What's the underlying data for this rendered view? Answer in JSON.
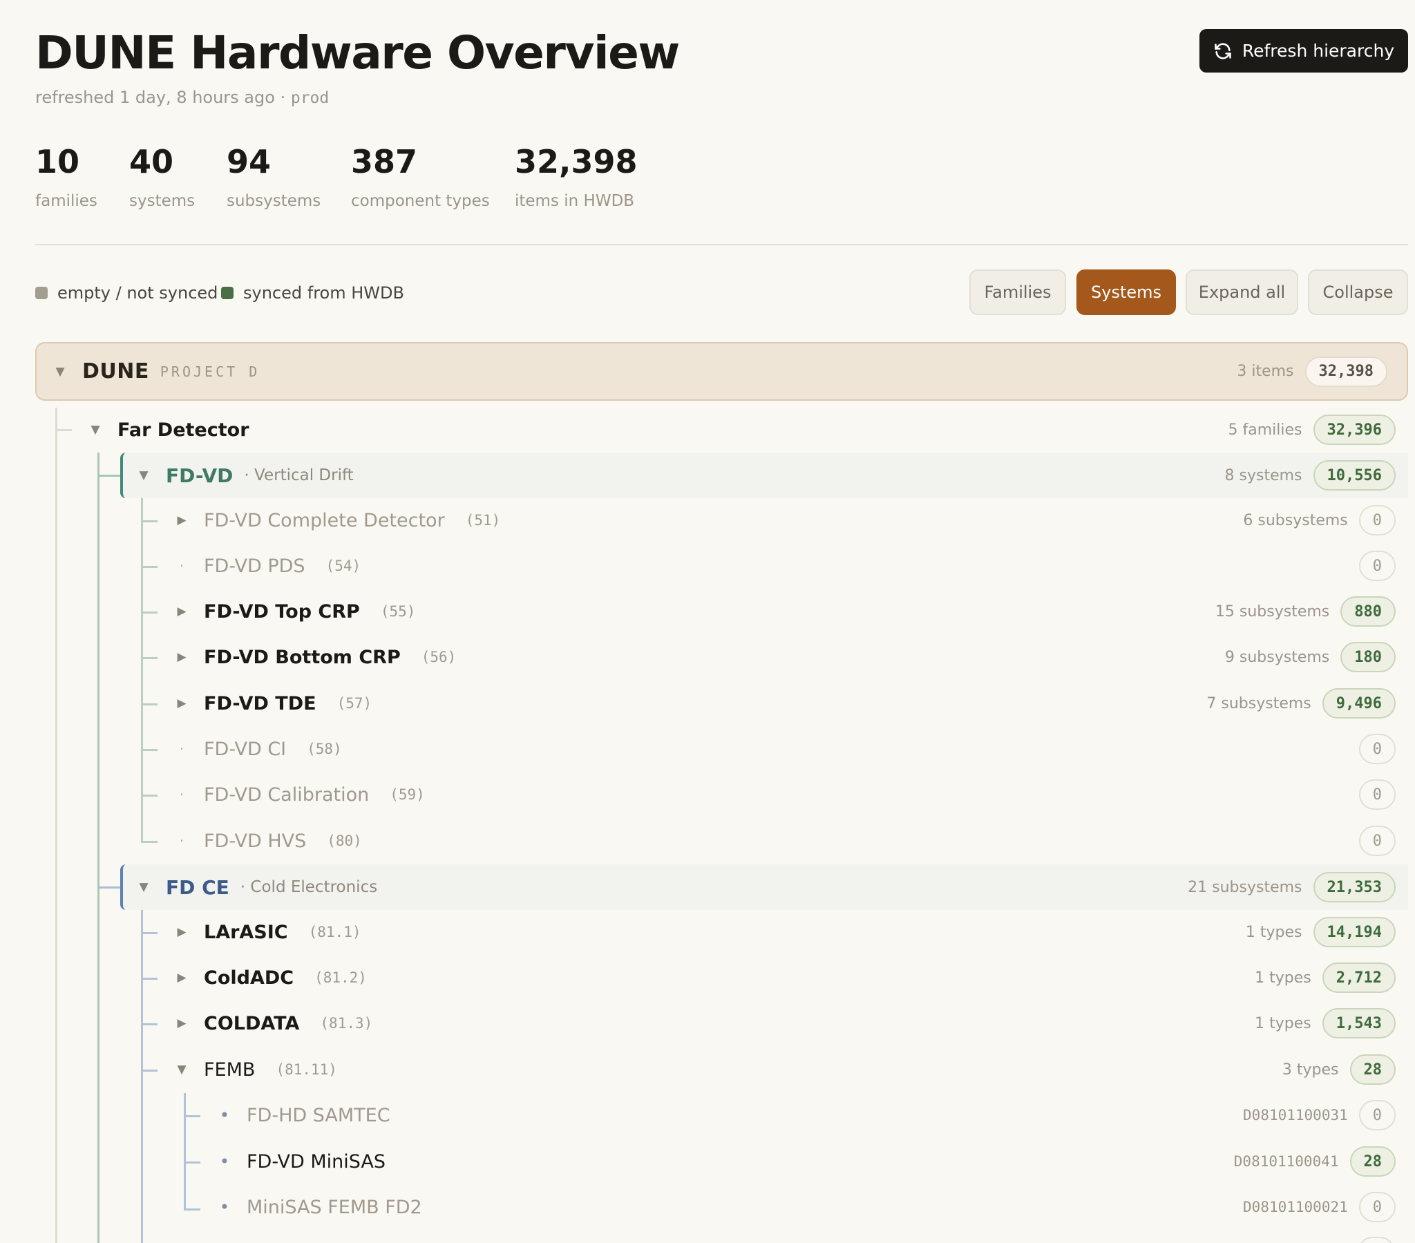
{
  "header": {
    "title": "DUNE Hardware Overview",
    "refreshed": "refreshed 1 day, 8 hours ago ·",
    "env": "prod",
    "refresh_button": "Refresh hierarchy"
  },
  "stats": [
    {
      "value": "10",
      "label": "families"
    },
    {
      "value": "40",
      "label": "systems"
    },
    {
      "value": "94",
      "label": "subsystems"
    },
    {
      "value": "387",
      "label": "component types"
    },
    {
      "value": "32,398",
      "label": "items in HWDB"
    }
  ],
  "legend": {
    "empty": "empty / not synced",
    "synced": "synced from HWDB",
    "empty_color": "#a39d90",
    "synced_color": "#4a6e45"
  },
  "views": {
    "families": "Families",
    "systems": "Systems",
    "expand": "Expand all",
    "collapse": "Collapse",
    "active": "Systems"
  },
  "tree": {
    "root": {
      "name": "DUNE",
      "tag": "PROJECT D",
      "meta": "3 items",
      "count": "32,398"
    },
    "far_detector": {
      "name": "Far Detector",
      "meta": "5 families",
      "count": "32,396"
    },
    "fdvd": {
      "name": "FD-VD",
      "desc": "· Vertical Drift",
      "meta": "8 systems",
      "count": "10,556",
      "systems": [
        {
          "name": "FD-VD Complete Detector",
          "code": "(51)",
          "meta": "6 subsystems",
          "count": "0"
        },
        {
          "name": "FD-VD PDS",
          "code": "(54)",
          "meta": "",
          "count": "0"
        },
        {
          "name": "FD-VD Top CRP",
          "code": "(55)",
          "meta": "15 subsystems",
          "count": "880"
        },
        {
          "name": "FD-VD Bottom CRP",
          "code": "(56)",
          "meta": "9 subsystems",
          "count": "180"
        },
        {
          "name": "FD-VD TDE",
          "code": "(57)",
          "meta": "7 subsystems",
          "count": "9,496"
        },
        {
          "name": "FD-VD CI",
          "code": "(58)",
          "meta": "",
          "count": "0"
        },
        {
          "name": "FD-VD Calibration",
          "code": "(59)",
          "meta": "",
          "count": "0"
        },
        {
          "name": "FD-VD HVS",
          "code": "(80)",
          "meta": "",
          "count": "0"
        }
      ]
    },
    "fdce": {
      "name": "FD CE",
      "desc": "· Cold Electronics",
      "meta": "21 subsystems",
      "count": "21,353",
      "subsystems": [
        {
          "name": "LArASIC",
          "code": "(81.1)",
          "meta": "1 types",
          "count": "14,194"
        },
        {
          "name": "ColdADC",
          "code": "(81.2)",
          "meta": "1 types",
          "count": "2,712"
        },
        {
          "name": "COLDATA",
          "code": "(81.3)",
          "meta": "1 types",
          "count": "1,543"
        },
        {
          "name": "FEMB",
          "code": "(81.11)",
          "meta": "3 types",
          "count": "28"
        }
      ],
      "types": [
        {
          "name": "FD-HD SAMTEC",
          "id": "D08101100031",
          "count": "0"
        },
        {
          "name": "FD-VD MiniSAS",
          "id": "D08101100041",
          "count": "28"
        },
        {
          "name": "MiniSAS FEMB FD2",
          "id": "D08101100021",
          "count": "0"
        }
      ]
    }
  }
}
